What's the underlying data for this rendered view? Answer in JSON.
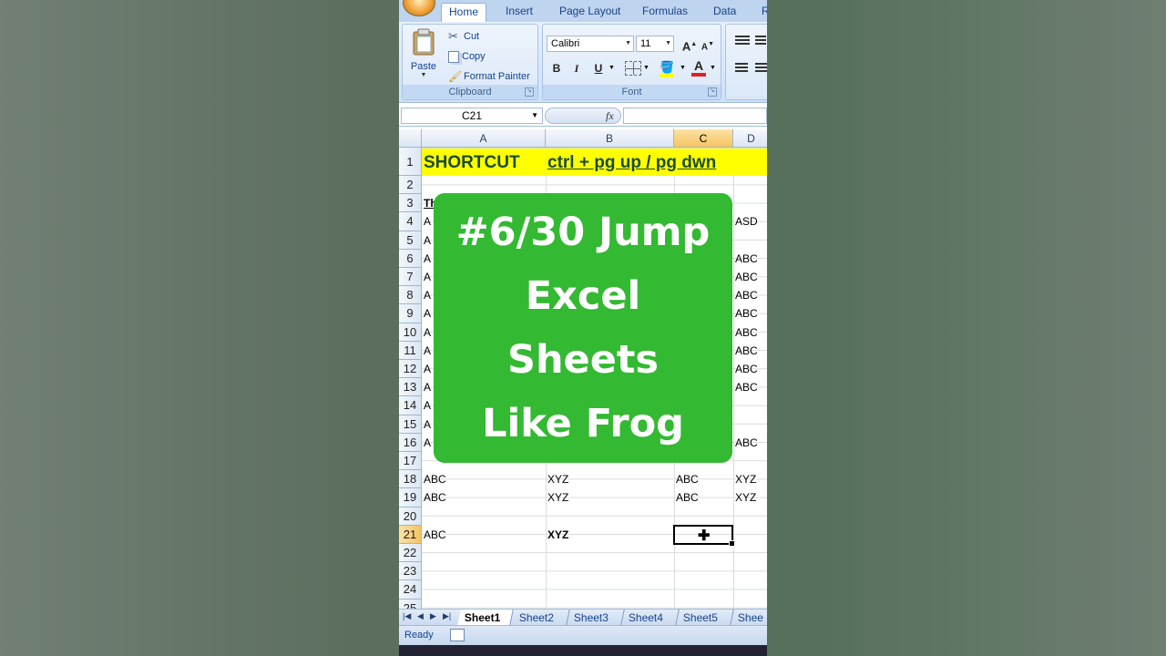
{
  "ribbon": {
    "tabs": [
      "Home",
      "Insert",
      "Page Layout",
      "Formulas",
      "Data",
      "R"
    ],
    "active_tab": "Home",
    "clipboard": {
      "paste_label": "Paste",
      "cut_label": "Cut",
      "copy_label": "Copy",
      "format_painter_label": "Format Painter",
      "group_label": "Clipboard"
    },
    "font": {
      "font_name": "Calibri",
      "font_size": "11",
      "grow_label": "A",
      "shrink_label": "A",
      "bold": "B",
      "italic": "I",
      "underline": "U",
      "font_color_label": "A",
      "group_label": "Font",
      "accent_red": "#e02020",
      "highlight_yellow": "#ffff00"
    }
  },
  "formula_bar": {
    "name_box": "C21",
    "fx_label": "fx",
    "value": ""
  },
  "sheet": {
    "columns": [
      "A",
      "B",
      "C",
      "D"
    ],
    "selected_column": "C",
    "rows": [
      "1",
      "2",
      "3",
      "4",
      "5",
      "6",
      "7",
      "8",
      "9",
      "10",
      "11",
      "12",
      "13",
      "14",
      "15",
      "16",
      "17",
      "18",
      "19",
      "20",
      "21",
      "22",
      "23",
      "24",
      "25"
    ],
    "selected_row": "21",
    "row1": {
      "a": "SHORTCUT",
      "b": "ctrl + pg up / pg dwn",
      "fill": "#ffff00"
    },
    "cells": {
      "a3": "Th",
      "a4": "A",
      "d4": "ASD",
      "a5": "A",
      "a6": "A",
      "d6": "ABC",
      "a7": "A",
      "d7": "ABC",
      "a8": "A",
      "d8": "ABC",
      "a9": "A",
      "d9": "ABC",
      "a10": "A",
      "d10": "ABC",
      "a11": "A",
      "d11": "ABC",
      "a12": "A",
      "d12": "ABC",
      "a13": "A",
      "d13": "ABC",
      "a14": "A",
      "a15": "A",
      "a16": "A",
      "d16": "ABC",
      "a18": "ABC",
      "b18": "XYZ",
      "c18": "ABC",
      "d18": "XYZ",
      "a19": "ABC",
      "b19": "XYZ",
      "c19": "ABC",
      "d19": "XYZ",
      "a21": "ABC",
      "b21": "XYZ"
    },
    "active_cell": "C21"
  },
  "sheet_tabs": [
    "Sheet1",
    "Sheet2",
    "Sheet3",
    "Sheet4",
    "Sheet5",
    "Shee"
  ],
  "active_sheet": "Sheet1",
  "status": {
    "mode": "Ready"
  },
  "overlay": {
    "lines": [
      "#6/30 Jump",
      "Excel",
      "Sheets",
      "Like Frog"
    ],
    "background": "#33b932"
  }
}
